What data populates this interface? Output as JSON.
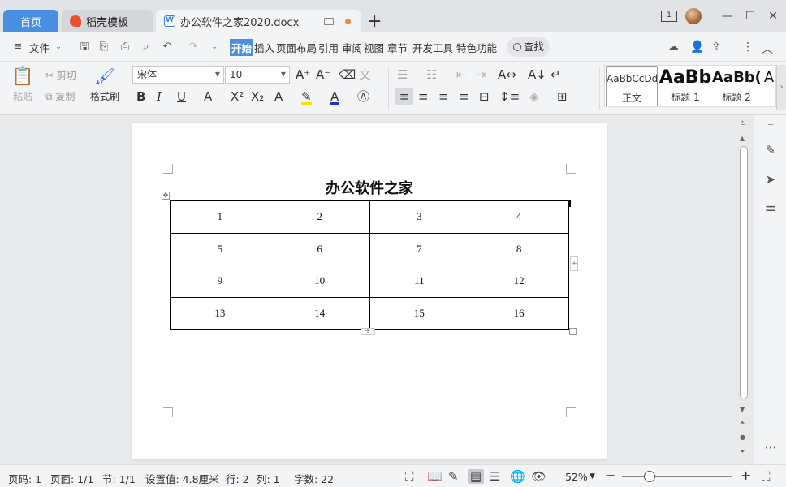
{
  "tabs": {
    "home": "首页",
    "template": "稻壳模板",
    "document": "办公软件之家2020.docx",
    "new_tab": "+"
  },
  "window": {
    "page_badge": "1",
    "minimize": "—",
    "restore": "☐",
    "close": "✕"
  },
  "menu": {
    "file": "文件",
    "items": [
      "开始",
      "插入",
      "页面布局",
      "引用",
      "审阅",
      "视图",
      "章节",
      "开发工具",
      "特色功能"
    ],
    "search": "查找"
  },
  "ribbon": {
    "paste": "粘贴",
    "cut": "剪切",
    "copy": "复制",
    "format_painter": "格式刷",
    "font_name": "宋体",
    "font_size": "10",
    "styles": [
      {
        "sample": "AaBbCcDd",
        "name": "正文"
      },
      {
        "sample": "AaBb",
        "name": "标题 1"
      },
      {
        "sample": "AaBb(",
        "name": "标题 2"
      },
      {
        "sample": "A",
        "name": ""
      }
    ]
  },
  "document": {
    "title": "办公软件之家",
    "table": [
      [
        "1",
        "2",
        "3",
        "4"
      ],
      [
        "5",
        "6",
        "7",
        "8"
      ],
      [
        "9",
        "10",
        "11",
        "12"
      ],
      [
        "13",
        "14",
        "15",
        "16"
      ]
    ]
  },
  "status": {
    "page_code": "页码: 1",
    "pages": "页面: 1/1",
    "section": "节: 1/1",
    "setting": "设置值: 4.8厘米",
    "row": "行: 2",
    "col": "列: 1",
    "word_count": "字数: 22",
    "zoom": "52%",
    "zoom_fraction": 0.25
  },
  "colors": {
    "accent": "#4a90e2",
    "template_icon": "#e8502a",
    "unsaved_dot": "#f08a3c"
  }
}
